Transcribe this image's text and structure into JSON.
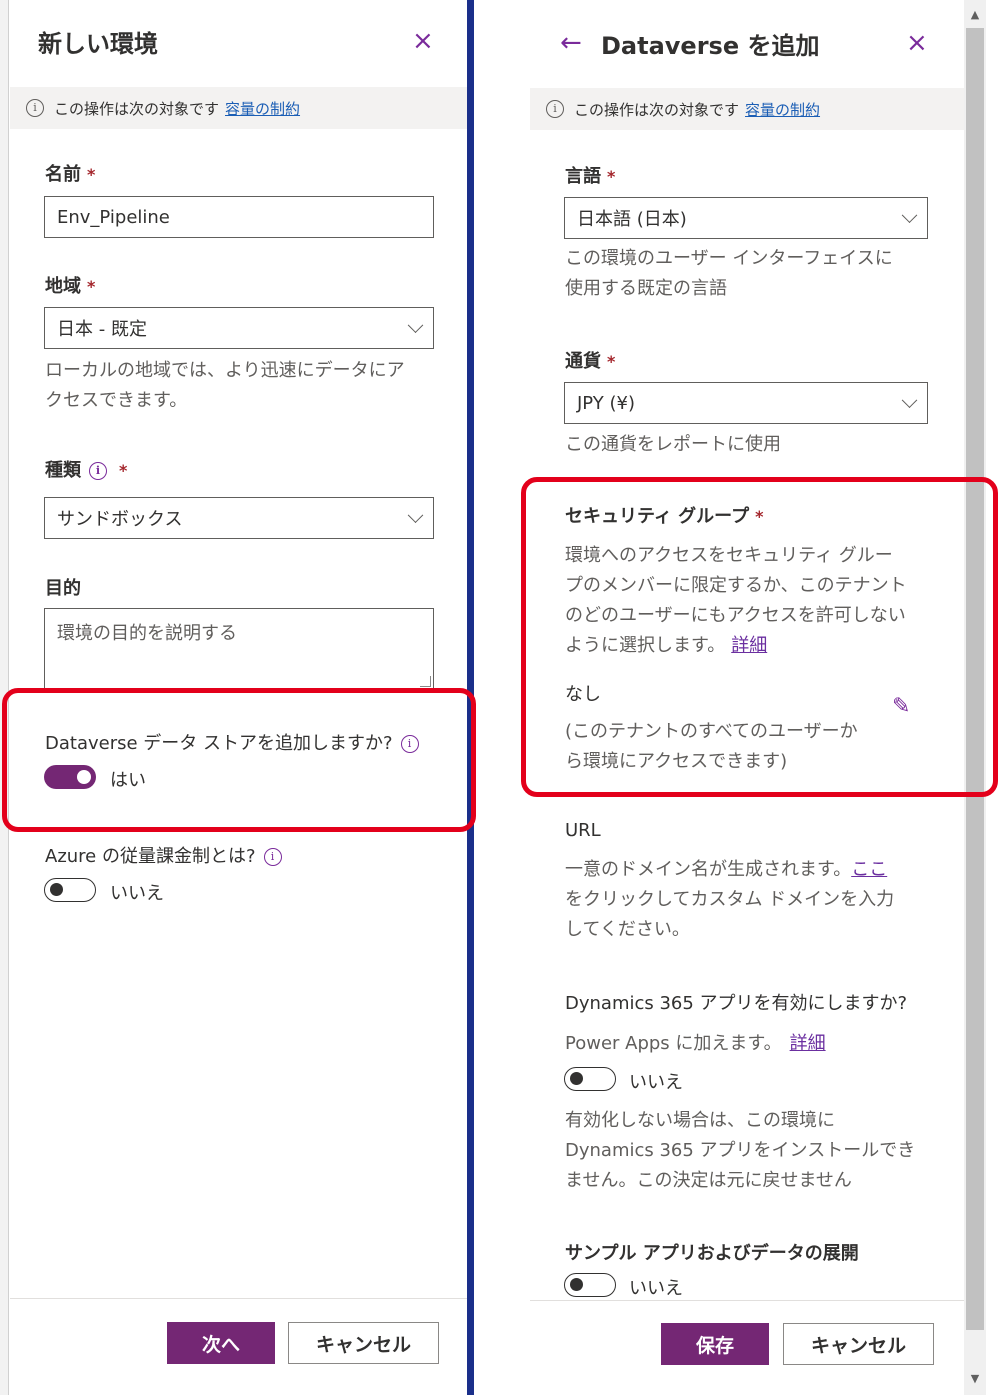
{
  "left_panel": {
    "title": "新しい環境",
    "close": "×",
    "info_text": "この操作は次の対象です",
    "info_link": "容量の制約",
    "name_label": "名前",
    "name_value": "Env_Pipeline",
    "region_label": "地域",
    "region_value": "日本 - 既定",
    "region_help_line1": "ローカルの地域では、より迅速にデータにア",
    "region_help_line2": "クセスできます。",
    "type_label": "種類",
    "type_value": "サンドボックス",
    "purpose_label": "目的",
    "purpose_placeholder": "環境の目的を説明する",
    "dataverse_question": "Dataverse データ ストアを追加しますか?",
    "dataverse_toggle_label": "はい",
    "azure_question": "Azure の従量課金制とは?",
    "azure_toggle_label": "いいえ",
    "next_button": "次へ",
    "cancel_button": "キャンセル",
    "required_mark": "*"
  },
  "right_panel": {
    "back": "←",
    "title": "Dataverse を追加",
    "close": "×",
    "info_text": "この操作は次の対象です",
    "info_link": "容量の制約",
    "language_label": "言語",
    "language_value": "日本語 (日本)",
    "language_help_line1": "この環境のユーザー インターフェイスに",
    "language_help_line2": "使用する既定の言語",
    "currency_label": "通貨",
    "currency_value": "JPY (¥)",
    "currency_help": "この通貨をレポートに使用",
    "security_label": "セキュリティ グループ",
    "security_help_line1": "環境へのアクセスをセキュリティ グルー",
    "security_help_line2": "プのメンバーに限定するか、このテナント",
    "security_help_line3": "のどのユーザーにもアクセスを許可しない",
    "security_help_line4": "ように選択します。",
    "security_link": "詳細",
    "security_value": "なし",
    "security_value_note_line1": "(このテナントのすべてのユーザーか",
    "security_value_note_line2": "ら環境にアクセスできます)",
    "url_label": "URL",
    "url_help_line1": "一意のドメイン名が生成されます。",
    "url_link": "ここ",
    "url_help_line2": "をクリックしてカスタム ドメインを入力",
    "url_help_line3": "してください。",
    "d365_label": "Dynamics 365 アプリを有効にしますか?",
    "d365_help": "Power Apps に加えます。",
    "d365_link": "詳細",
    "d365_toggle_label": "いいえ",
    "d365_note_line1": "有効化しない場合は、この環境に",
    "d365_note_line2": "Dynamics 365 アプリをインストールでき",
    "d365_note_line3": "ません。この決定は元に戻せません",
    "sample_label": "サンプル アプリおよびデータの展開",
    "sample_toggle_label": "いいえ",
    "save_button": "保存",
    "cancel_button": "キャンセル",
    "required_mark": "*"
  },
  "scrollbar": {
    "up": "▲",
    "down": "▼"
  },
  "colors": {
    "accent": "#742774",
    "highlight": "#e3001b",
    "link": "#1b5eb5"
  }
}
